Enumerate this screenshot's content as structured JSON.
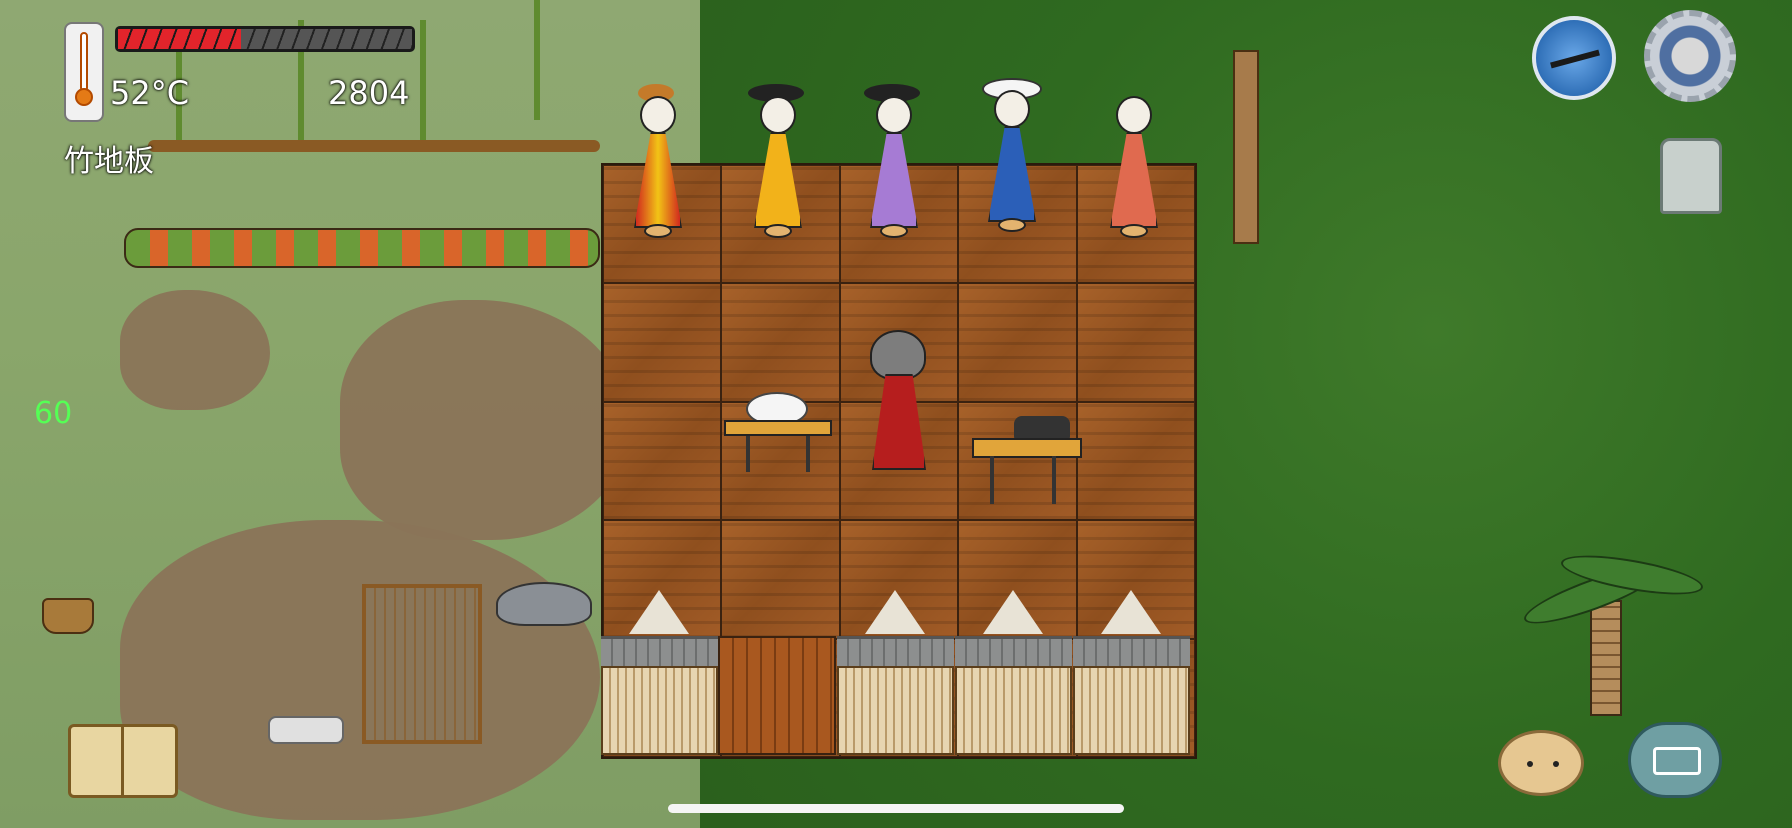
{
  "hud": {
    "temperature": "52°C",
    "score": "2804",
    "location_label": "竹地板",
    "fps": "60",
    "health_fraction": 0.42
  },
  "colors": {
    "health_red": "#e2242b",
    "fps_green": "#55ff55",
    "floor_wood": "#a8622a",
    "grass_dark": "#2f6a20",
    "grass_light": "#8fa872"
  },
  "icons": [
    "thermometer-icon",
    "compass-icon",
    "gear-icon",
    "coin-icon",
    "book-icon",
    "emote-icon",
    "keyboard-icon"
  ]
}
